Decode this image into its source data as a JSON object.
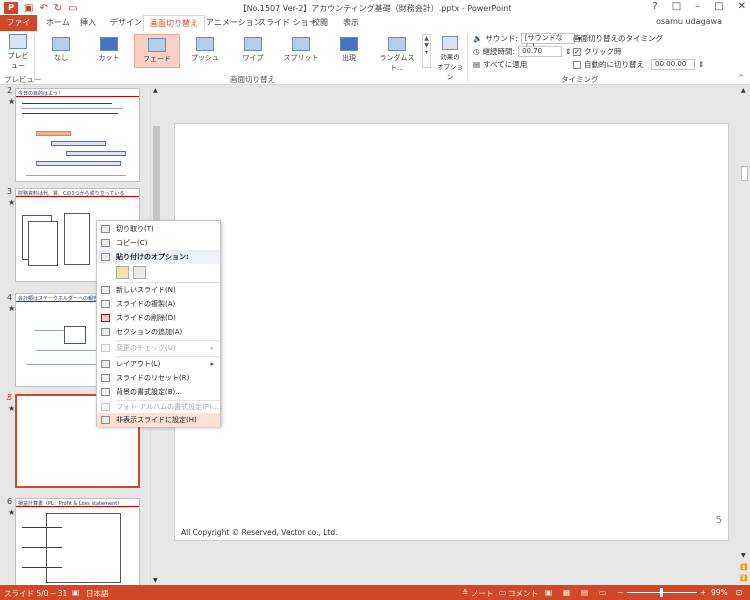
{
  "window": {
    "title": "【No.1507 Ver-2】アカウンティング基礎（財務会計）.pptx - PowerPoint",
    "controls": [
      "?",
      "□",
      "–",
      "□",
      "✕"
    ],
    "user": "osamu udagawa"
  },
  "tabs": [
    "ファイル",
    "ホーム",
    "挿入",
    "デザイン",
    "画面切り替え",
    "アニメーション",
    "スライド ショー",
    "校閲",
    "表示"
  ],
  "ribbon": {
    "preview_label": "プレビュー",
    "preview_group": "プレビュー",
    "transitions": [
      "なし",
      "カット",
      "フェード",
      "プッシュ",
      "ワイプ",
      "スプリット",
      "出現",
      "ランダムスト..."
    ],
    "effect_options": "効果の\nオプション",
    "transitions_group": "画面切り替え",
    "sound_label": "サウンド:",
    "sound_value": "[サウンドなし]",
    "duration_label": "継続時間:",
    "duration_value": "00.70",
    "apply_all": "すべてに適用",
    "advance_header": "画面切り替えのタイミング",
    "on_click": "クリック時",
    "after_label": "自動的に切り替え",
    "after_value": "00:00.00",
    "timing_group": "タイミング"
  },
  "thumbs": [
    {
      "num": "2",
      "title": "今日の目的はよう！"
    },
    {
      "num": "3",
      "title": "財務資料は代、賃、Cの3つから成り立っている"
    },
    {
      "num": "4",
      "title": "会計類はステークホルダーへの報告書"
    },
    {
      "num": "5",
      "title": ""
    },
    {
      "num": "6",
      "title": "損益計算書（PL：Profit & Loss statement）"
    }
  ],
  "context_menu": {
    "items": [
      {
        "label": "切り取り(T)",
        "disabled": false,
        "icon": "scissors-icon"
      },
      {
        "label": "コピー(C)",
        "disabled": false,
        "icon": "copy-icon"
      },
      {
        "label": "貼り付けのオプション:",
        "disabled": false,
        "icon": "paste-icon",
        "header": true
      },
      {
        "label": "新しいスライド(N)",
        "disabled": false,
        "icon": "new-slide-icon"
      },
      {
        "label": "スライドの複製(A)",
        "disabled": false,
        "icon": "duplicate-icon"
      },
      {
        "label": "スライドの削除(D)",
        "disabled": false,
        "icon": "delete-slide-icon"
      },
      {
        "label": "セクションの追加(A)",
        "disabled": false,
        "icon": "section-icon"
      },
      {
        "label": "変更のチェック(U)",
        "disabled": true,
        "icon": "compare-icon",
        "submenu": true
      },
      {
        "label": "レイアウト(L)",
        "disabled": false,
        "icon": "layout-icon",
        "submenu": true
      },
      {
        "label": "スライドのリセット(R)",
        "disabled": false,
        "icon": "reset-icon"
      },
      {
        "label": "背景の書式設定(B)...",
        "disabled": false,
        "icon": "background-icon"
      },
      {
        "label": "フォト アルバムの書式設定(P)...",
        "disabled": true,
        "icon": "photo-album-icon"
      },
      {
        "label": "非表示スライドに設定(H)",
        "disabled": false,
        "icon": "hide-slide-icon",
        "highlighted": true
      }
    ]
  },
  "slide": {
    "copyright": "All Copyright © Reserved, Vector co., Ltd.",
    "page_number": "5"
  },
  "status": {
    "slide_info": "スライド 5/0 ─ 31",
    "language": "日本語",
    "notes": "ノート",
    "comments": "コメント",
    "zoom": "99%",
    "zoom_minus": "−",
    "zoom_plus": "+"
  },
  "colors": {
    "accent": "#d24726",
    "selected_transition": "#f8d0c4",
    "menu_highlight": "#fde0d6"
  }
}
